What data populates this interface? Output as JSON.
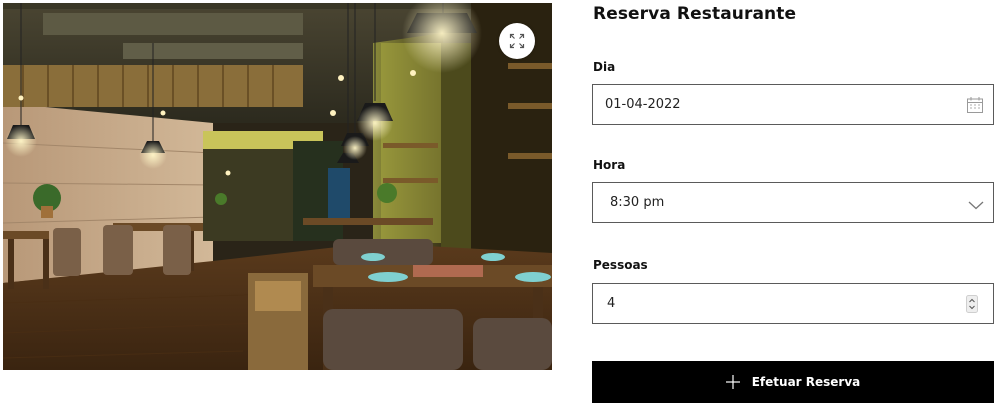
{
  "form": {
    "title": "Reserva Restaurante",
    "date": {
      "label": "Dia",
      "value": "01-04-2022",
      "icon": "calendar-icon"
    },
    "time": {
      "label": "Hora",
      "value": "8:30 pm",
      "icon": "chevron-down-icon"
    },
    "guests": {
      "label": "Pessoas",
      "value": "4",
      "icon": "spinner-icon"
    },
    "submit": {
      "label": "Efetuar Reserva",
      "icon": "plus-icon"
    }
  },
  "image": {
    "expand_icon": "expand-icon"
  },
  "colors": {
    "button_bg": "#000000",
    "button_text": "#ffffff",
    "border": "#5a5a5a",
    "text": "#111111"
  }
}
